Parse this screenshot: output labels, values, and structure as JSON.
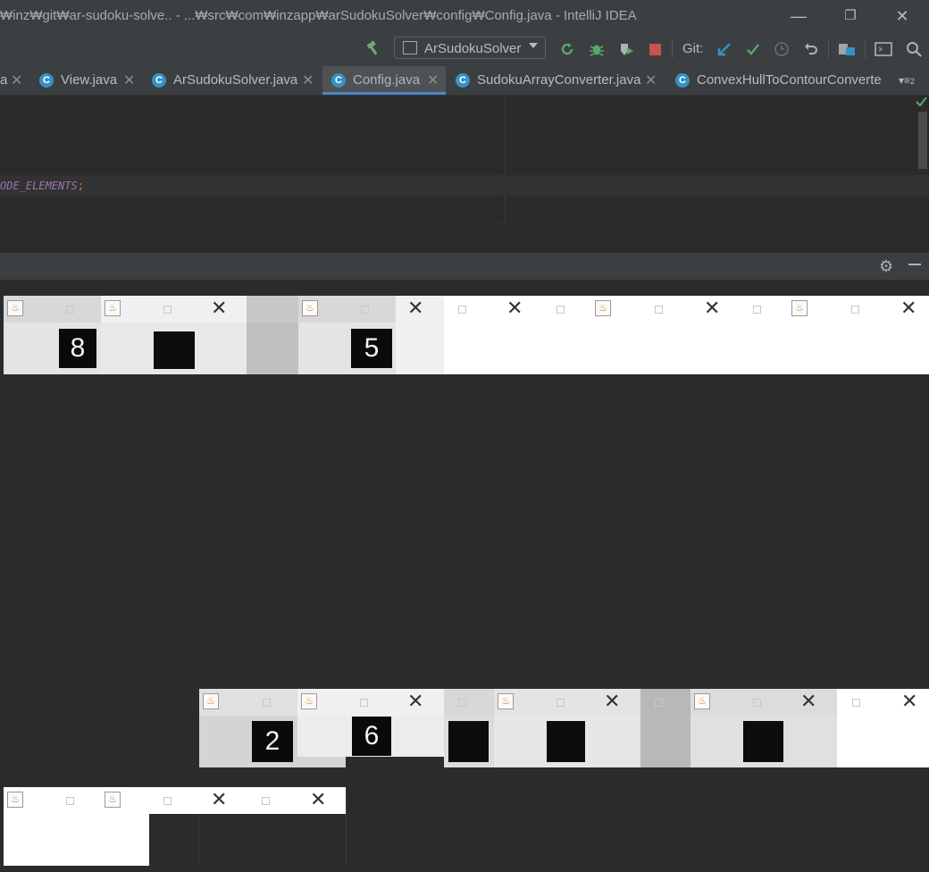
{
  "window": {
    "title": "₩inz₩git₩ar-sudoku-solve.. - ...₩src₩com₩inzapp₩arSudokuSolver₩config₩Config.java - IntelliJ IDEA",
    "controls": {
      "minimize": "—",
      "restore": "❐",
      "close": "✕"
    }
  },
  "toolbar": {
    "build_icon": "hammer-icon",
    "run_config": "ArSudokuSolver",
    "git_label": "Git:"
  },
  "tabs": [
    {
      "label": "a",
      "close": "✕",
      "active": false
    },
    {
      "label": "View.java",
      "close": "✕",
      "active": false
    },
    {
      "label": "ArSudokuSolver.java",
      "close": "✕",
      "active": false
    },
    {
      "label": "Config.java",
      "close": "✕",
      "active": true
    },
    {
      "label": "SudokuArrayConverter.java",
      "close": "✕",
      "active": false
    },
    {
      "label": "ConvexHullToContourConverte",
      "close": "",
      "active": false
    }
  ],
  "tab_overflow": "▾≡",
  "tab_overflow_count": "2",
  "tab_class_icon": "C",
  "editor": {
    "code_text": "ODE_ELEMENTS",
    "code_semicolon": ";"
  },
  "panel": {
    "settings_icon": "gear-icon",
    "hide_icon": "minus-icon"
  },
  "java_windows": {
    "close_glyph": "✕",
    "java_icon_glyph": "♨",
    "digits": [
      "8",
      "5",
      "2",
      "6"
    ]
  },
  "colors": {
    "accent": "#4a88c7",
    "ide_bg": "#2b2b2b",
    "panel_bg": "#3c3f41",
    "class_icon": "#3592c4"
  }
}
